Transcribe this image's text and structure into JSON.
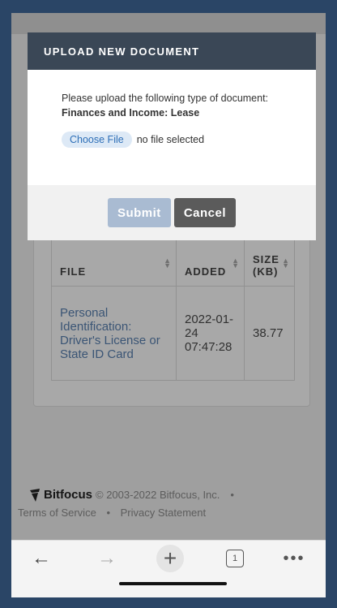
{
  "modal": {
    "title": "UPLOAD NEW DOCUMENT",
    "prompt": "Please upload the following type of document:",
    "document_type": "Finances and Income: Lease",
    "choose_file_label": "Choose File",
    "file_status": "no file selected",
    "submit_label": "Submit",
    "cancel_label": "Cancel"
  },
  "table": {
    "headers": {
      "file": "FILE",
      "added": "ADDED",
      "size_line1": "SIZE",
      "size_line2": "(KB)"
    },
    "rows": [
      {
        "file": "Personal Identification: Driver's License or State ID Card",
        "added": "2022-01-24 07:47:28",
        "size": "38.77"
      }
    ]
  },
  "footer": {
    "brand": "Bitfocus",
    "copyright": "© 2003-2022 Bitfocus, Inc.",
    "dot": "•",
    "terms": "Terms of Service",
    "privacy": "Privacy Statement"
  },
  "toolbar": {
    "back_icon": "back-arrow-icon",
    "forward_icon": "forward-arrow-icon",
    "new_tab_icon": "plus-icon",
    "tab_count": "1",
    "more_icon": "more-dots-icon"
  },
  "colors": {
    "modal_header": "#3a4756",
    "submit_button": "#a9bbd2",
    "cancel_button": "#5b5b5b",
    "link": "#5a82b2"
  }
}
